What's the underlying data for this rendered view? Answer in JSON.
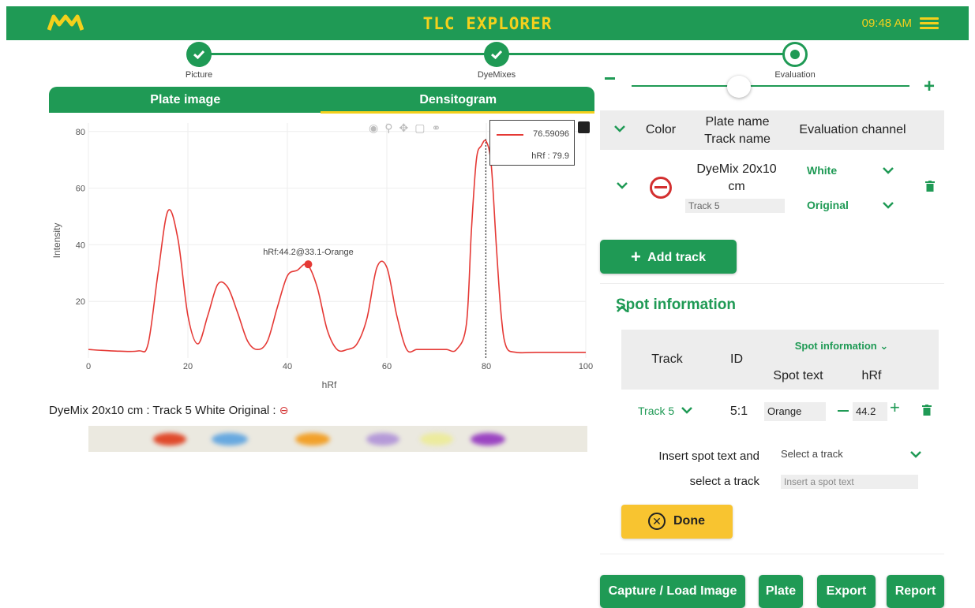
{
  "header": {
    "title": "TLC EXPLORER",
    "time": "09:48 AM",
    "brand_color": "#1f9a55",
    "accent_color": "#f4d01c"
  },
  "stepper": {
    "steps": [
      {
        "label": "Picture",
        "state": "done"
      },
      {
        "label": "DyeMixes",
        "state": "done"
      },
      {
        "label": "Evaluation",
        "state": "current"
      }
    ]
  },
  "left_panel": {
    "tabs": [
      "Plate image",
      "Densitogram"
    ],
    "active_tab": "Densitogram",
    "tooltip": {
      "value": "76.59096",
      "hrf": "hRf : 79.9"
    },
    "annotation": "hRf:44.2@33.1-Orange",
    "track_caption": "DyeMix 20x10 cm : Track 5 White Original :"
  },
  "chart_data": {
    "type": "line",
    "xlabel": "hRf",
    "ylabel": "Intensity",
    "xlim": [
      0,
      100
    ],
    "ylim": [
      0,
      83
    ],
    "xticks": [
      0,
      20,
      40,
      60,
      80,
      100
    ],
    "yticks": [
      20,
      40,
      60,
      80
    ],
    "line_color": "#e53935",
    "x": [
      0,
      5,
      10,
      12,
      14,
      16,
      18,
      20,
      22,
      24,
      26,
      28,
      30,
      32,
      34,
      36,
      38,
      40,
      42,
      44,
      46,
      48,
      50,
      52,
      54,
      56,
      58,
      60,
      62,
      64,
      66,
      68,
      70,
      72,
      74,
      76,
      77,
      78,
      79,
      80,
      81,
      82,
      83,
      84,
      86,
      90,
      95,
      100
    ],
    "y": [
      3,
      2.5,
      2.5,
      5,
      30,
      52,
      42,
      15,
      5,
      15,
      26,
      25,
      16,
      6,
      3,
      6,
      18,
      29,
      31,
      33,
      25,
      10,
      3,
      3,
      5,
      14,
      32,
      32,
      15,
      3,
      3,
      3,
      3,
      3,
      3,
      12,
      45,
      70,
      75,
      76.5,
      68,
      40,
      15,
      4,
      2,
      2,
      2,
      2
    ],
    "marker": {
      "x": 44.2,
      "y": 33.1
    },
    "vline_x": 79.9
  },
  "plate_strip": {
    "spots": [
      {
        "color": "#e04a2c"
      },
      {
        "color": "#68a9e0"
      },
      {
        "color": "#f2a12a"
      },
      {
        "color": "#b59ad8"
      },
      {
        "color": "#eceb9e"
      },
      {
        "color": "#9b45c2"
      }
    ]
  },
  "right_panel": {
    "track_table": {
      "headers": {
        "color": "Color",
        "plate_name": "Plate name",
        "track_name": "Track name",
        "channel": "Evaluation channel"
      },
      "row": {
        "plate_name": "DyeMix 20x10 cm",
        "track_name": "Track 5",
        "channel": "White",
        "mode": "Original"
      }
    },
    "add_track_label": "Add track",
    "spot_info": {
      "title": "Spot information",
      "headers": {
        "track": "Track",
        "id": "ID",
        "spot_info_select": "Spot information",
        "spot_text": "Spot text",
        "hrf": "hRf"
      },
      "row": {
        "track": "Track 5",
        "id": "5:1",
        "spot_text": "Orange",
        "hrf": "44.2"
      },
      "insert_label_1": "Insert spot text and",
      "insert_label_2": "select a track",
      "select_track_placeholder": "Select a track",
      "spot_text_placeholder": "Insert a spot text",
      "done_label": "Done"
    },
    "buttons": {
      "capture": "Capture / Load Image",
      "plate": "Plate",
      "export": "Export",
      "report": "Report"
    }
  }
}
